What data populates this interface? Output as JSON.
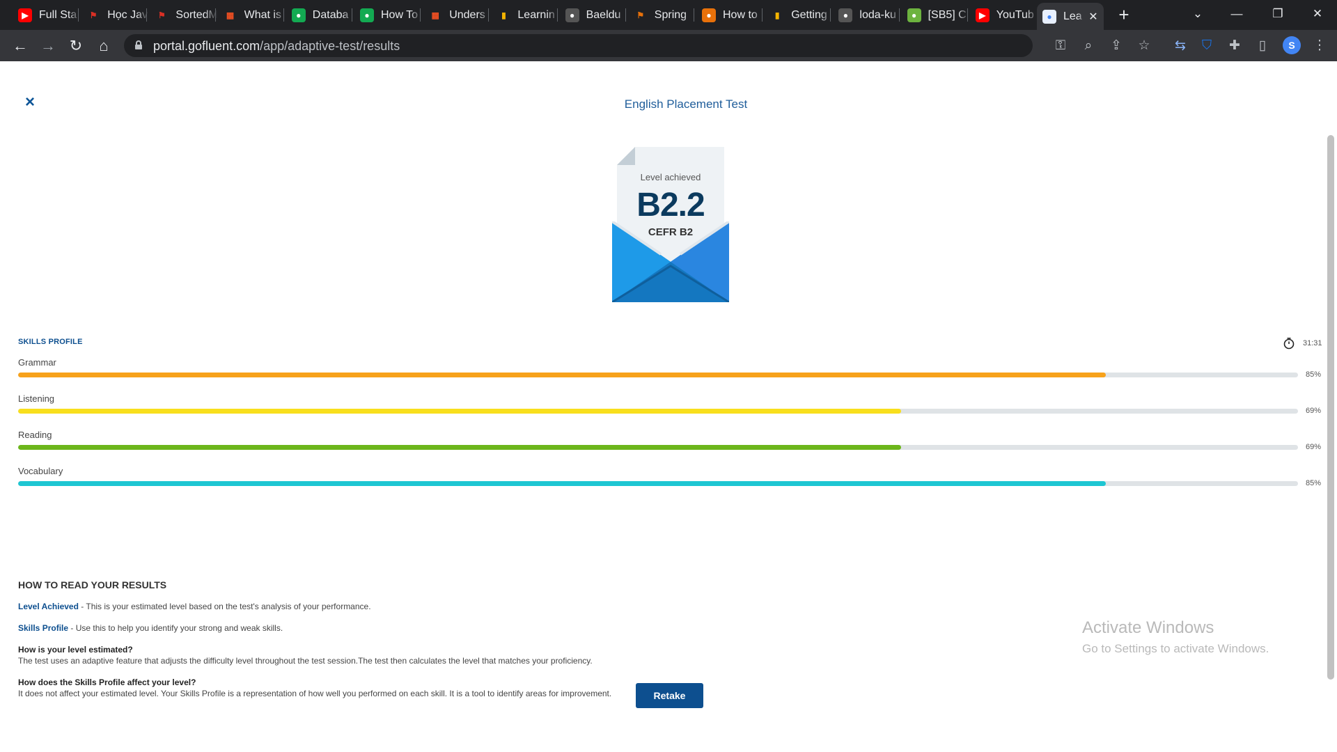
{
  "browser": {
    "tabs": [
      {
        "label": "Full Sta",
        "icon": "youtube-icon",
        "color": "#ff0000"
      },
      {
        "label": "Học Jav",
        "icon": "flag-icon",
        "color": "#d93025"
      },
      {
        "label": "SortedM",
        "icon": "flag-icon",
        "color": "#d93025"
      },
      {
        "label": "What is",
        "icon": "microsoft-icon",
        "color": "#f25022"
      },
      {
        "label": "Databa",
        "icon": "leaf-icon",
        "color": "#13aa52"
      },
      {
        "label": "How To",
        "icon": "leaf-icon",
        "color": "#13aa52"
      },
      {
        "label": "Unders",
        "icon": "microsoft-icon",
        "color": "#f25022"
      },
      {
        "label": "Learnin",
        "icon": "bars-icon",
        "color": "#f4b400"
      },
      {
        "label": "Baeldu",
        "icon": "github-icon",
        "color": "#555555"
      },
      {
        "label": "Spring",
        "icon": "flag-icon",
        "color": "#e8710a"
      },
      {
        "label": "How to",
        "icon": "circle-icon",
        "color": "#e8710a"
      },
      {
        "label": "Getting",
        "icon": "bars-icon",
        "color": "#f4b400"
      },
      {
        "label": "loda-ku",
        "icon": "github-icon",
        "color": "#555555"
      },
      {
        "label": "[SB5] C",
        "icon": "spring-icon",
        "color": "#6db33f"
      },
      {
        "label": "YouTub",
        "icon": "youtube-icon",
        "color": "#ff0000"
      }
    ],
    "active_tab": {
      "label": "Lea",
      "icon": "gofluent-icon",
      "color": "#4285f4"
    },
    "url": {
      "host": "portal.gofluent.com",
      "path": "/app/adaptive-test/results"
    }
  },
  "page": {
    "test_title": "English Placement Test",
    "level": {
      "label": "Level achieved",
      "value": "B2.2",
      "cefr": "CEFR B2"
    },
    "skills_title": "SKILLS PROFILE",
    "timer": "31:31",
    "skills": [
      {
        "name": "Grammar",
        "percent_text": "85%",
        "fraction": 0.85,
        "color": "#f7a21b"
      },
      {
        "name": "Listening",
        "percent_text": "69%",
        "fraction": 0.69,
        "color": "#f8df1d"
      },
      {
        "name": "Reading",
        "percent_text": "69%",
        "fraction": 0.69,
        "color": "#6cb61b"
      },
      {
        "name": "Vocabulary",
        "percent_text": "85%",
        "fraction": 0.85,
        "color": "#1ec6d2"
      }
    ],
    "how_title": "HOW TO READ YOUR RESULTS",
    "level_achieved": {
      "lead": "Level Achieved",
      "text": " - This is your estimated level based on the test's analysis of your performance."
    },
    "skills_profile": {
      "lead": "Skills Profile",
      "text": " - Use this to help you identify your strong and weak skills."
    },
    "q1": {
      "question": "How is your level estimated?",
      "answer": "The test uses an adaptive feature that adjusts the difficulty level throughout the test session.The test then calculates the level that matches your proficiency."
    },
    "q2": {
      "question": "How does the Skills Profile affect your level?",
      "answer": "It does not affect your estimated level. Your Skills Profile is a representation of how well you performed on each skill. It is a tool to identify areas for improvement."
    },
    "retake_label": "Retake"
  },
  "os": {
    "watermark_title": "Activate Windows",
    "watermark_sub": "Go to Settings to activate Windows."
  }
}
